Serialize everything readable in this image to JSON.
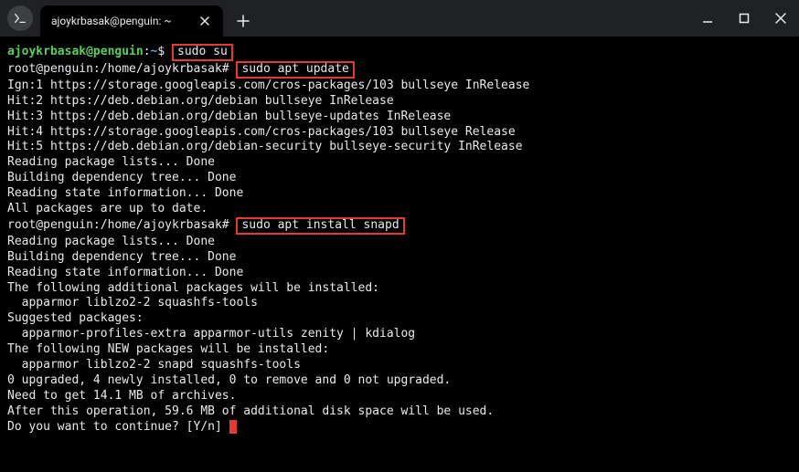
{
  "tab": {
    "title": "ajoykrbasak@penguin: ~"
  },
  "prompt1": {
    "user_host": "ajoykrbasak@penguin",
    "sep": ":",
    "path": "~",
    "sym": "$",
    "cmd": "sudo su"
  },
  "prompt2": {
    "prefix": "root@penguin:/home/ajoykrbasak#",
    "cmd": "sudo apt update"
  },
  "out1": [
    "Ign:1 https://storage.googleapis.com/cros-packages/103 bullseye InRelease",
    "Hit:2 https://deb.debian.org/debian bullseye InRelease",
    "Hit:3 https://deb.debian.org/debian bullseye-updates InRelease",
    "Hit:4 https://storage.googleapis.com/cros-packages/103 bullseye Release",
    "Hit:5 https://deb.debian.org/debian-security bullseye-security InRelease",
    "Reading package lists... Done",
    "Building dependency tree... Done",
    "Reading state information... Done",
    "All packages are up to date."
  ],
  "prompt3": {
    "prefix": "root@penguin:/home/ajoykrbasak#",
    "cmd": "sudo apt install snapd"
  },
  "out2": [
    "Reading package lists... Done",
    "Building dependency tree... Done",
    "Reading state information... Done",
    "The following additional packages will be installed:",
    "  apparmor liblzo2-2 squashfs-tools",
    "Suggested packages:",
    "  apparmor-profiles-extra apparmor-utils zenity | kdialog",
    "The following NEW packages will be installed:",
    "  apparmor liblzo2-2 snapd squashfs-tools",
    "0 upgraded, 4 newly installed, 0 to remove and 0 not upgraded.",
    "Need to get 14.1 MB of archives.",
    "After this operation, 59.6 MB of additional disk space will be used.",
    "Do you want to continue? [Y/n] "
  ]
}
